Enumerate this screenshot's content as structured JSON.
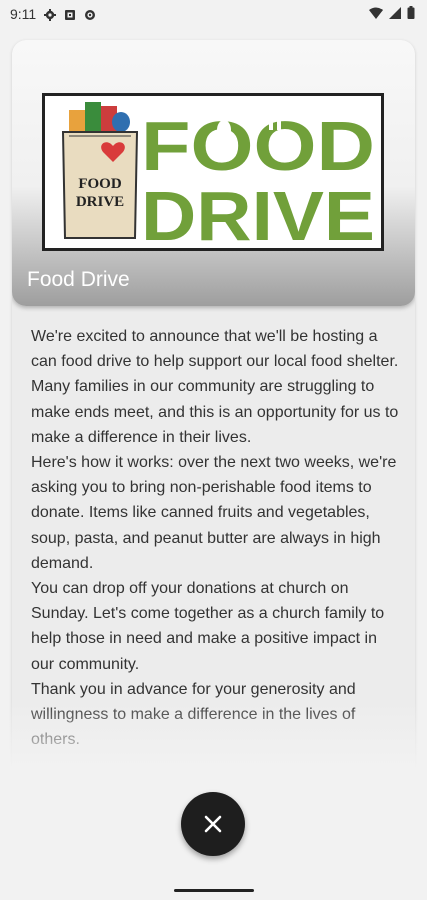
{
  "status_bar": {
    "time": "9:11",
    "left_icons": [
      "gear-icon",
      "sim-card-icon",
      "settings-alt-icon"
    ],
    "right_icons": [
      "wifi-icon",
      "signal-icon",
      "battery-icon"
    ]
  },
  "card": {
    "logo": {
      "bag_text_line1": "FOOD",
      "bag_text_line2": "DRIVE",
      "big_text_line1": "FOOD",
      "big_text_line2": "DRIVE",
      "green": "#71a03a"
    },
    "title": "Food Drive",
    "paragraphs": [
      "We're excited to announce that we'll be hosting a can food drive to help support our local food shelter. Many families in our community are struggling to make ends meet, and this is an opportunity for us to make a difference in their lives.",
      "Here's how it works: over the next two weeks, we're asking you to bring non-perishable food items to donate. Items like canned fruits and vegetables, soup, pasta, and peanut butter are always in high demand.",
      "You can drop off your donations at church on Sunday. Let's come together as a church family to help those in need and make a positive impact in our community.",
      "Thank you in advance for your generosity and willingness to make a difference in the lives of others."
    ]
  },
  "fab": {
    "icon": "close-icon"
  }
}
